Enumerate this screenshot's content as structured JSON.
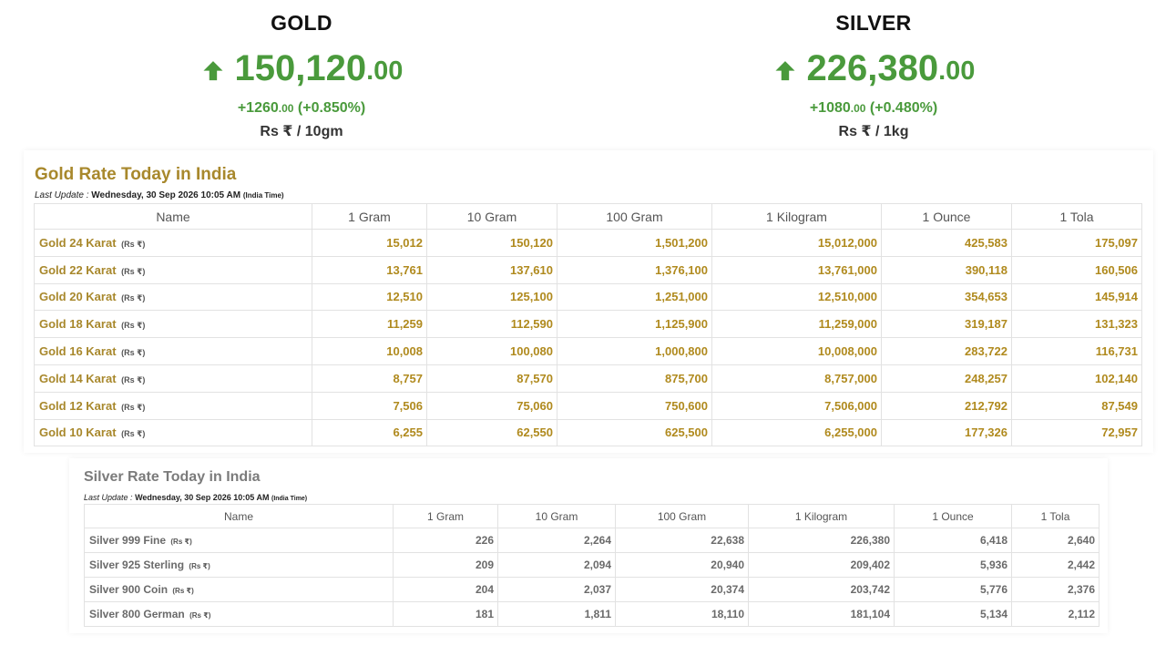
{
  "ticker": {
    "gold": {
      "name": "GOLD",
      "price_int": "150,120",
      "price_dec": ".00",
      "change_abs": "+1260",
      "change_abs_dec": ".00",
      "change_pct": "(+0.850%)",
      "unit": "Rs ₹ / 10gm",
      "trend_icon": "arrow-up-icon",
      "color": "#4a9a3c"
    },
    "silver": {
      "name": "SILVER",
      "price_int": "226,380",
      "price_dec": ".00",
      "change_abs": "+1080",
      "change_abs_dec": ".00",
      "change_pct": "(+0.480%)",
      "unit": "Rs ₹ / 1kg",
      "trend_icon": "arrow-up-icon",
      "color": "#4a9a3c"
    }
  },
  "gold_table": {
    "title": "Gold Rate Today in India",
    "last_update_label": "Last Update :",
    "last_update_value": "Wednesday, 30 Sep 2026 10:05 AM",
    "last_update_tz": "(India Time)",
    "columns": [
      "Name",
      "1 Gram",
      "10 Gram",
      "100 Gram",
      "1 Kilogram",
      "1 Ounce",
      "1 Tola"
    ],
    "unit_tag": "(Rs ₹)",
    "rows": [
      {
        "name": "Gold 24 Karat",
        "values": [
          "15,012",
          "150,120",
          "1,501,200",
          "15,012,000",
          "425,583",
          "175,097"
        ]
      },
      {
        "name": "Gold 22 Karat",
        "values": [
          "13,761",
          "137,610",
          "1,376,100",
          "13,761,000",
          "390,118",
          "160,506"
        ]
      },
      {
        "name": "Gold 20 Karat",
        "values": [
          "12,510",
          "125,100",
          "1,251,000",
          "12,510,000",
          "354,653",
          "145,914"
        ]
      },
      {
        "name": "Gold 18 Karat",
        "values": [
          "11,259",
          "112,590",
          "1,125,900",
          "11,259,000",
          "319,187",
          "131,323"
        ]
      },
      {
        "name": "Gold 16 Karat",
        "values": [
          "10,008",
          "100,080",
          "1,000,800",
          "10,008,000",
          "283,722",
          "116,731"
        ]
      },
      {
        "name": "Gold 14 Karat",
        "values": [
          "8,757",
          "87,570",
          "875,700",
          "8,757,000",
          "248,257",
          "102,140"
        ]
      },
      {
        "name": "Gold 12 Karat",
        "values": [
          "7,506",
          "75,060",
          "750,600",
          "7,506,000",
          "212,792",
          "87,549"
        ]
      },
      {
        "name": "Gold 10 Karat",
        "values": [
          "6,255",
          "62,550",
          "625,500",
          "6,255,000",
          "177,326",
          "72,957"
        ]
      }
    ],
    "accent_color": "#a8882c"
  },
  "silver_table": {
    "title": "Silver Rate Today in India",
    "last_update_label": "Last Update :",
    "last_update_value": "Wednesday, 30 Sep 2026 10:05 AM",
    "last_update_tz": "(India Time)",
    "columns": [
      "Name",
      "1 Gram",
      "10 Gram",
      "100 Gram",
      "1 Kilogram",
      "1 Ounce",
      "1 Tola"
    ],
    "unit_tag": "(Rs ₹)",
    "rows": [
      {
        "name": "Silver 999 Fine",
        "values": [
          "226",
          "2,264",
          "22,638",
          "226,380",
          "6,418",
          "2,640"
        ]
      },
      {
        "name": "Silver 925 Sterling",
        "values": [
          "209",
          "2,094",
          "20,940",
          "209,402",
          "5,936",
          "2,442"
        ]
      },
      {
        "name": "Silver 900 Coin",
        "values": [
          "204",
          "2,037",
          "20,374",
          "203,742",
          "5,776",
          "2,376"
        ]
      },
      {
        "name": "Silver 800 German",
        "values": [
          "181",
          "1,811",
          "18,110",
          "181,104",
          "5,134",
          "2,112"
        ]
      }
    ],
    "accent_color": "#7b7b7b"
  }
}
